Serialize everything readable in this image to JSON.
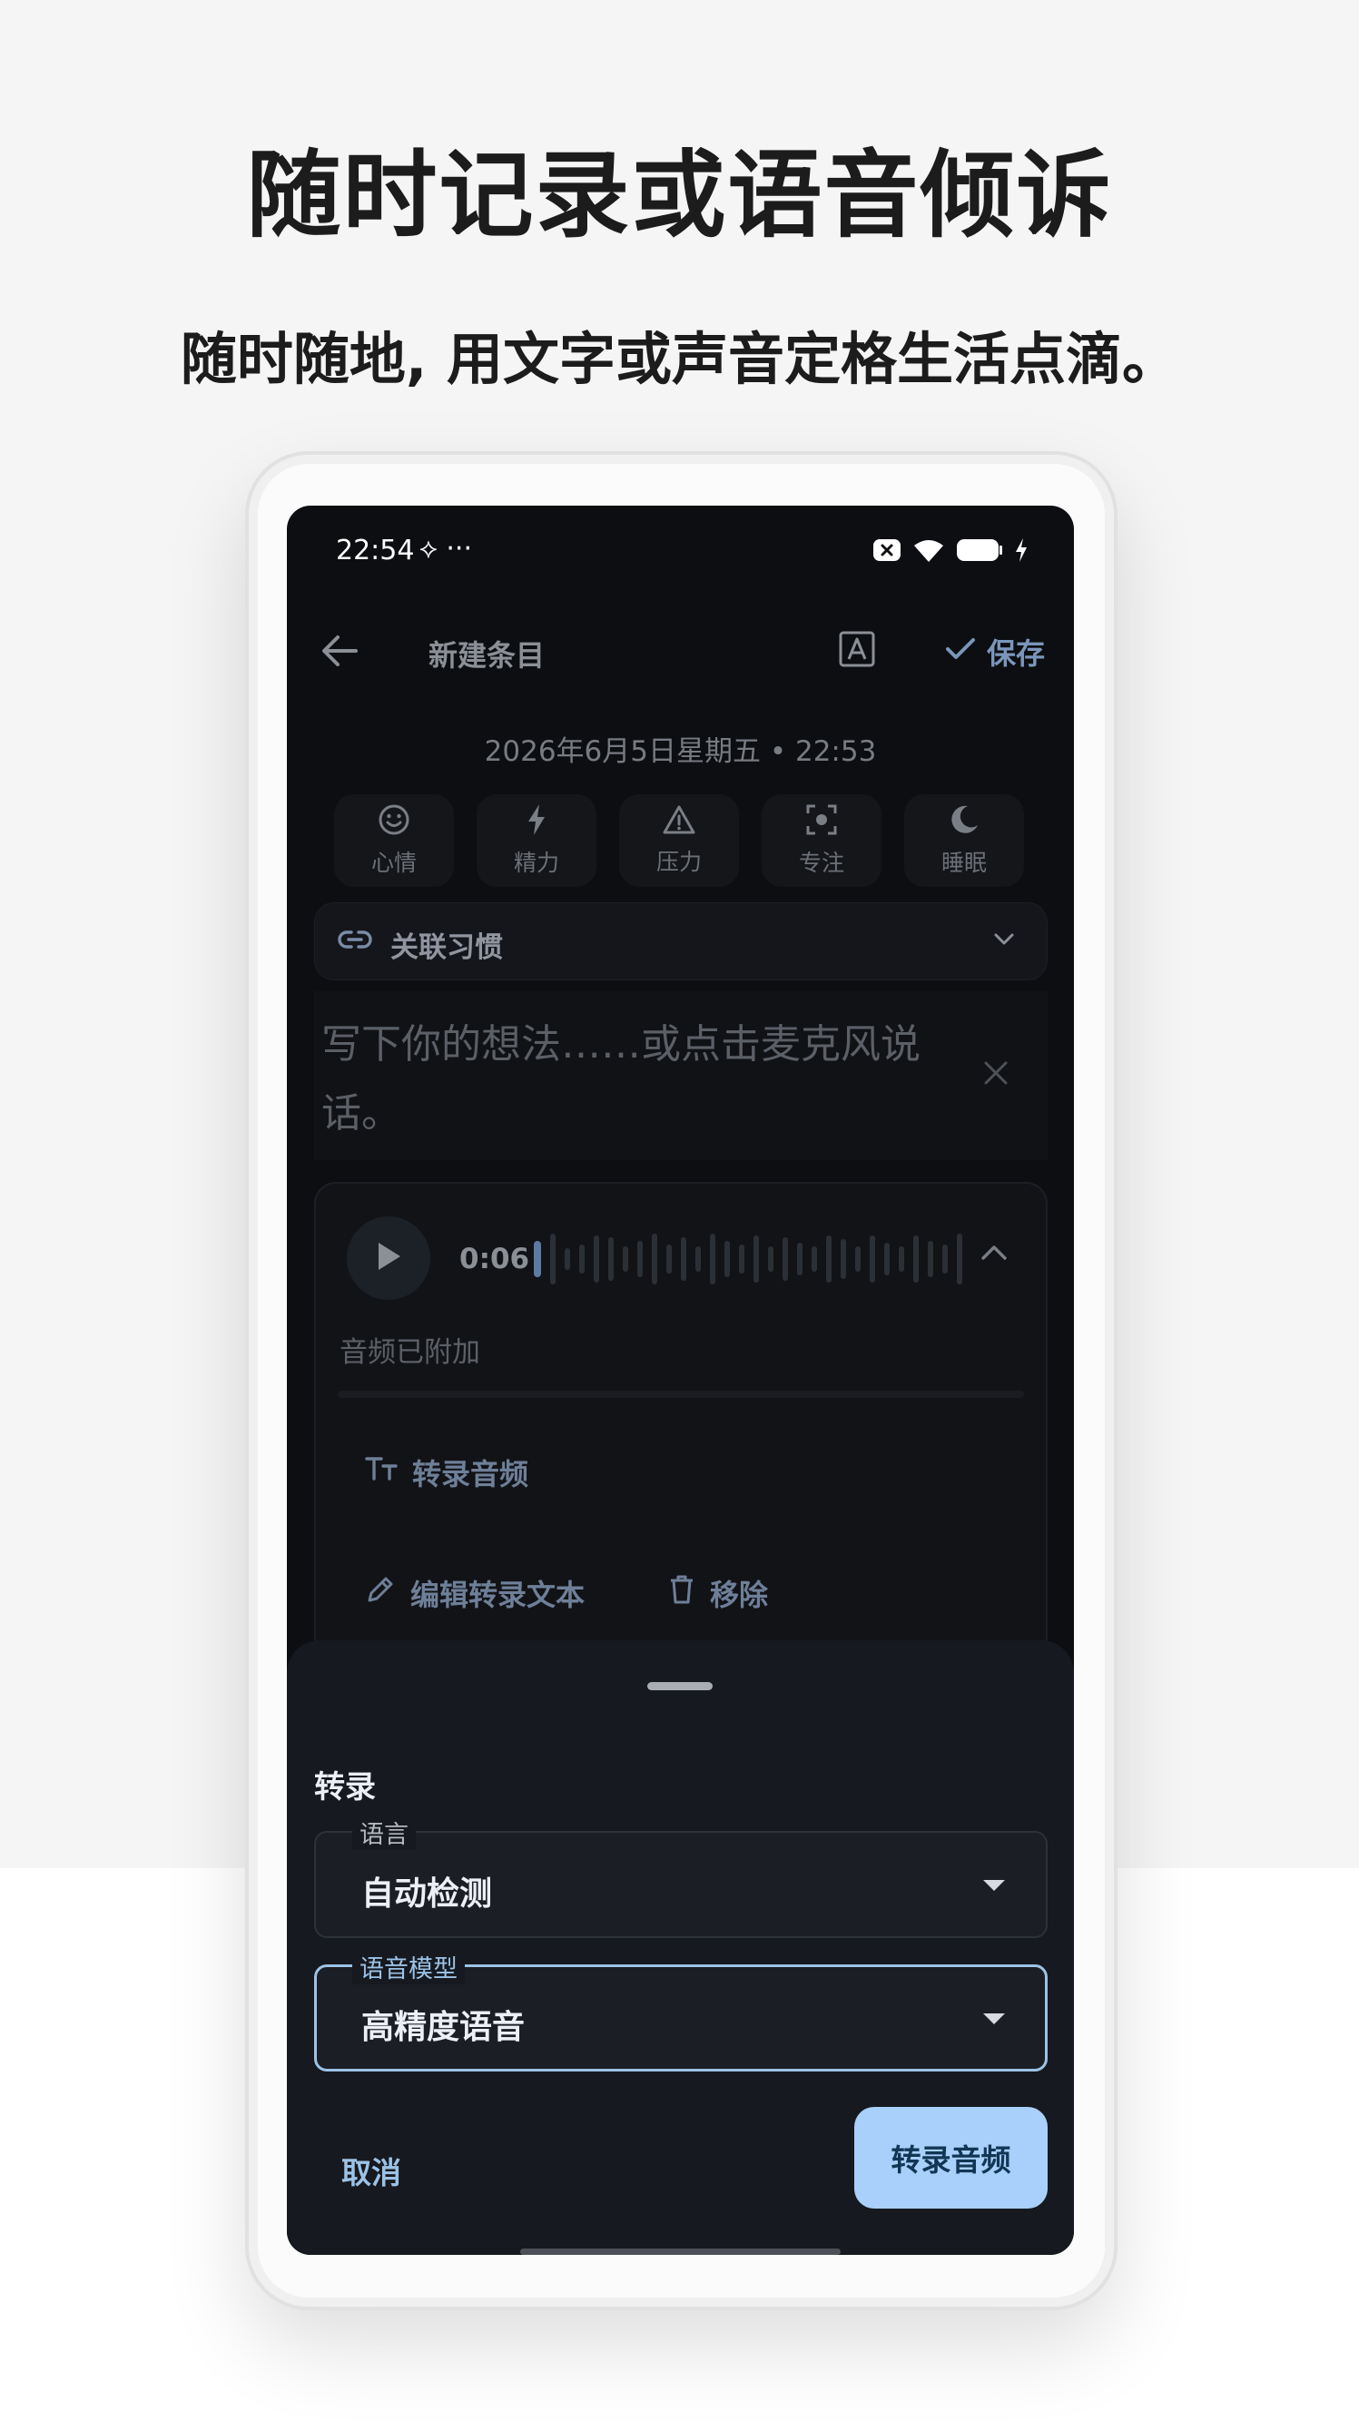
{
  "promo": {
    "headline": "随时记录或语音倾诉",
    "subheadline": "随时随地, 用文字或声音定格生活点滴。"
  },
  "status_bar": {
    "time": "22:54",
    "extra": "⟡ ···"
  },
  "app_bar": {
    "title": "新建条目",
    "save_label": "保存"
  },
  "entry": {
    "datetime": "2026年6月5日星期五 • 22:53",
    "metrics": [
      {
        "label": "心情",
        "icon": "smile-icon"
      },
      {
        "label": "精力",
        "icon": "bolt-icon"
      },
      {
        "label": "压力",
        "icon": "warning-icon"
      },
      {
        "label": "专注",
        "icon": "focus-icon"
      },
      {
        "label": "睡眠",
        "icon": "moon-icon"
      }
    ],
    "habit_link_label": "关联习惯",
    "text_placeholder": "写下你的想法……或点击麦克风说话。"
  },
  "audio": {
    "duration": "0:06",
    "status": "音频已附加",
    "transcribe_label": "转录音频",
    "edit_transcript_label": "编辑转录文本",
    "remove_label": "移除"
  },
  "sheet": {
    "title": "转录",
    "language_label": "语言",
    "language_value": "自动检测",
    "model_label": "语音模型",
    "model_value": "高精度语音",
    "cancel_label": "取消",
    "confirm_label": "转录音频"
  },
  "colors": {
    "accent": "#a8d0fb",
    "focus_border": "#9cc2e6",
    "sheet_bg": "#16191f"
  }
}
